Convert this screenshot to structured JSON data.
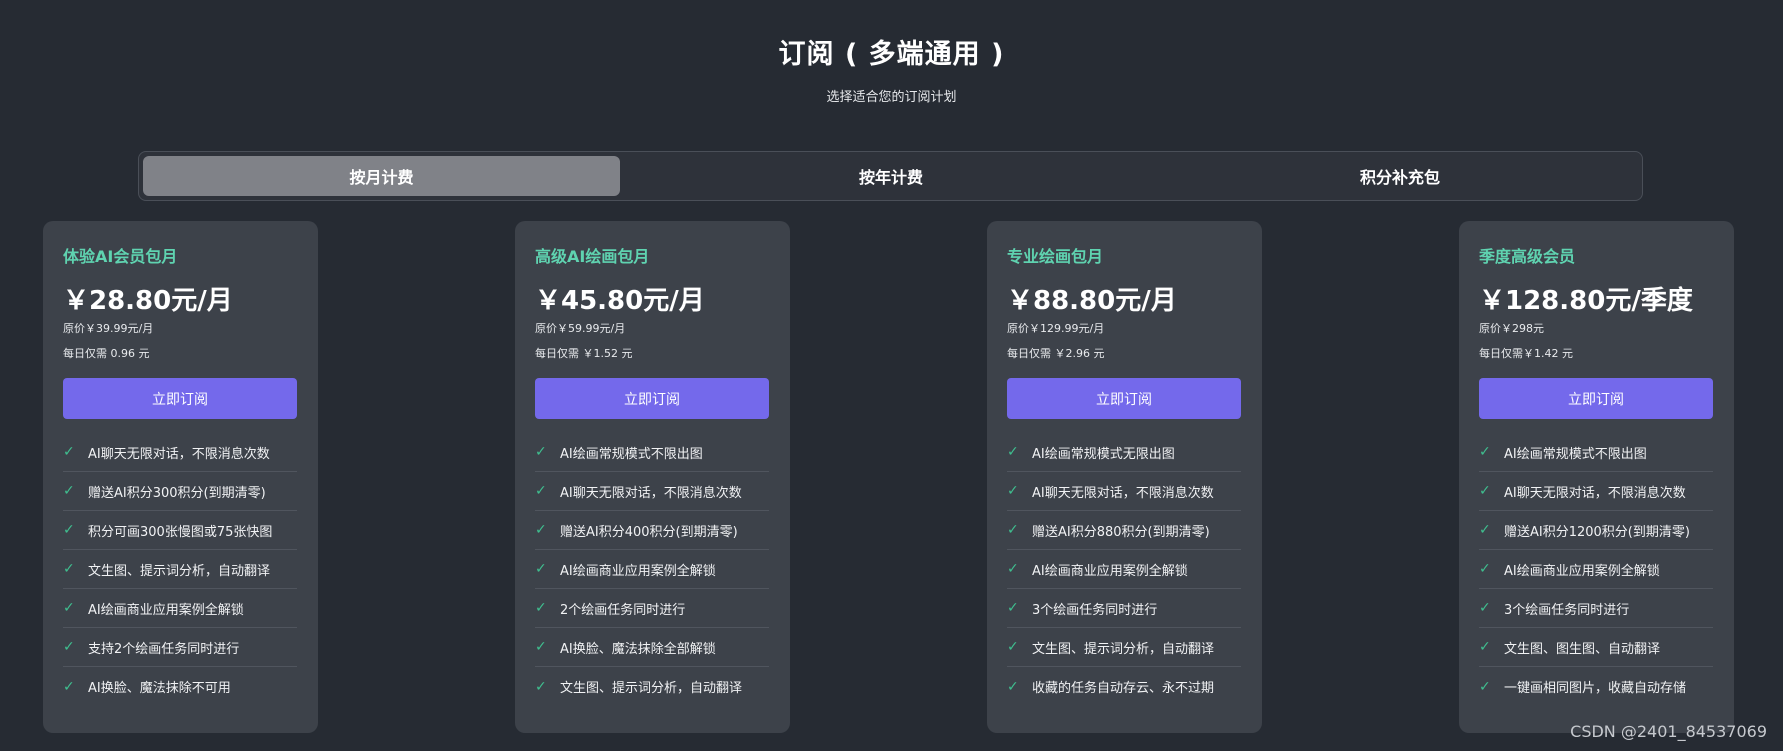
{
  "header": {
    "title": "订阅 ( 多端通用 )",
    "subtitle": "选择适合您的订阅计划"
  },
  "tabs": [
    {
      "label": "按月计费",
      "active": true
    },
    {
      "label": "按年计费",
      "active": false
    },
    {
      "label": "积分补充包",
      "active": false
    }
  ],
  "plans": [
    {
      "name": "体验AI会员包月",
      "price": "￥28.80元/月",
      "original": "原价￥39.99元/月",
      "daily": "每日仅需 0.96 元",
      "button": "立即订阅",
      "features": [
        "AI聊天无限对话，不限消息次数",
        "赠送AI积分300积分(到期清零)",
        "积分可画300张慢图或75张快图",
        "文生图、提示词分析，自动翻译",
        "AI绘画商业应用案例全解锁",
        "支持2个绘画任务同时进行",
        "AI换脸、魔法抹除不可用"
      ]
    },
    {
      "name": "高级AI绘画包月",
      "price": "￥45.80元/月",
      "original": "原价￥59.99元/月",
      "daily": "每日仅需 ￥1.52 元",
      "button": "立即订阅",
      "features": [
        "AI绘画常规模式不限出图",
        "AI聊天无限对话，不限消息次数",
        "赠送AI积分400积分(到期清零)",
        "AI绘画商业应用案例全解锁",
        "2个绘画任务同时进行",
        "AI换脸、魔法抹除全部解锁",
        "文生图、提示词分析，自动翻译"
      ]
    },
    {
      "name": "专业绘画包月",
      "price": "￥88.80元/月",
      "original": "原价￥129.99元/月",
      "daily": "每日仅需 ￥2.96 元",
      "button": "立即订阅",
      "features": [
        "AI绘画常规模式无限出图",
        "AI聊天无限对话，不限消息次数",
        "赠送AI积分880积分(到期清零)",
        "AI绘画商业应用案例全解锁",
        "3个绘画任务同时进行",
        "文生图、提示词分析，自动翻译",
        "收藏的任务自动存云、永不过期"
      ]
    },
    {
      "name": "季度高级会员",
      "price": "￥128.80元/季度",
      "original": "原价￥298元",
      "daily": "每日仅需￥1.42 元",
      "button": "立即订阅",
      "features": [
        "AI绘画常规模式不限出图",
        "AI聊天无限对话，不限消息次数",
        "赠送AI积分1200积分(到期清零)",
        "AI绘画商业应用案例全解锁",
        "3个绘画任务同时进行",
        "文生图、图生图、自动翻译",
        "一键画相同图片，收藏自动存储"
      ]
    }
  ],
  "watermark": "CSDN @2401_84537069",
  "colors": {
    "background": "#262b33",
    "card": "#3d424a",
    "accent_name": "#5fd3b0",
    "button": "#7469eb",
    "check": "#3fbf8f",
    "active_tab": "#808288"
  },
  "icons": {
    "feature_check": "check-icon"
  }
}
